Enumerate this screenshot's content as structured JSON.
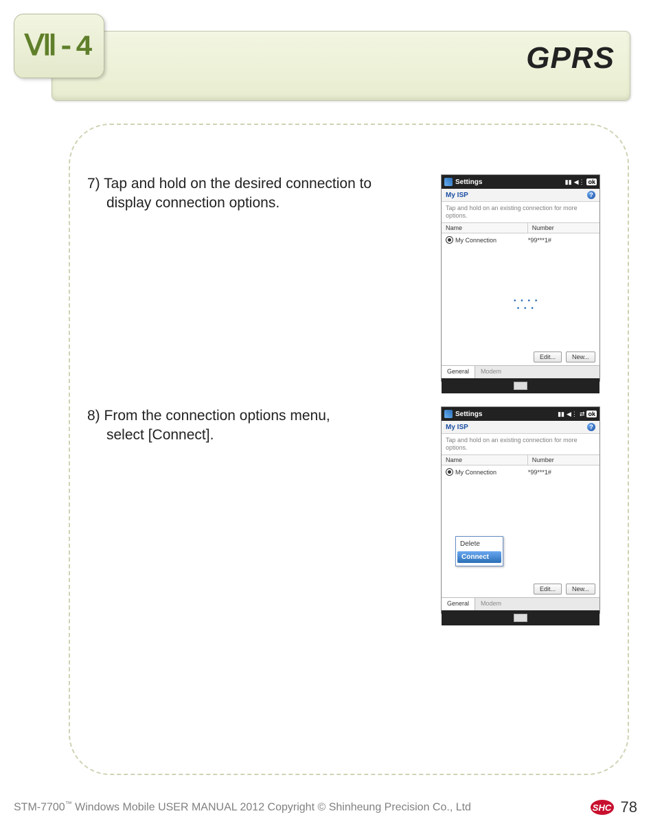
{
  "header": {
    "section_number": "Ⅶ-4",
    "title": "GPRS"
  },
  "steps": {
    "step7": {
      "number": "7)",
      "text_line1": "Tap and hold on the desired connection to",
      "text_line2": "display connection options."
    },
    "step8": {
      "number": "8)",
      "text_line1": "From the connection options menu,",
      "text_line2": "select [Connect]."
    }
  },
  "wm_common": {
    "top_title": "Settings",
    "ok": "ok",
    "isp": "My ISP",
    "hint": "Tap and hold on an existing connection for more options.",
    "col_name": "Name",
    "col_number": "Number",
    "row_name": "My Connection",
    "row_number": "*99***1#",
    "btn_edit": "Edit...",
    "btn_new": "New...",
    "tab_general": "General",
    "tab_modem": "Modem"
  },
  "context_menu": {
    "delete": "Delete",
    "connect": "Connect"
  },
  "footer": {
    "text_prefix": "STM-7700",
    "tm": "™",
    "text_suffix": " Windows Mobile USER MANUAL  2012 Copyright © Shinheung Precision Co., Ltd",
    "badge": "SHC",
    "page": "78"
  }
}
